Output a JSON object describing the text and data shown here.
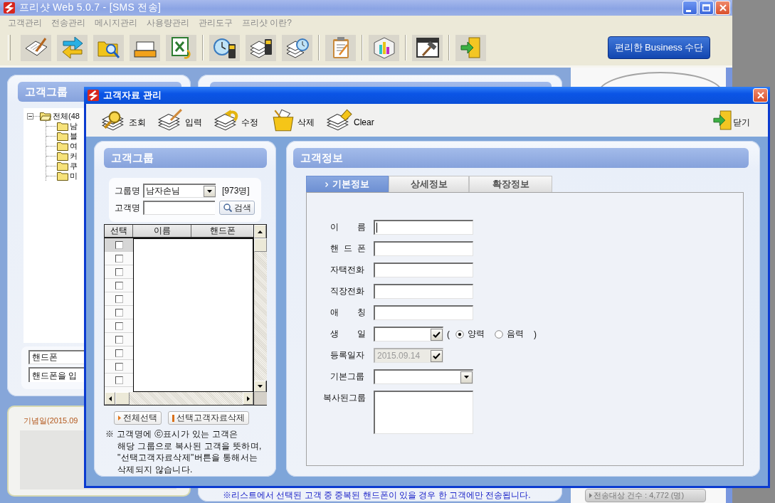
{
  "main_window": {
    "title": "프리샷 Web 5.0.7 - [SMS 전송]",
    "menu": [
      "고객관리",
      "전송관리",
      "메시지관리",
      "사용량관리",
      "관리도구",
      "프리샷 이란?"
    ],
    "business_button": "편리한 Business 수단"
  },
  "group_panel": {
    "title": "고객그룹",
    "tree": {
      "label": "전체(48",
      "expanded": true,
      "children": [
        {
          "label": "남"
        },
        {
          "label": "블"
        },
        {
          "label": "여"
        },
        {
          "label": "커"
        },
        {
          "label": "쿠"
        },
        {
          "label": "미"
        }
      ]
    },
    "search_type": "핸드폰",
    "search_value": "핸드폰을 입"
  },
  "anniversary_panel": {
    "title": "기념일(2015.09"
  },
  "send_panel": {
    "notice": "※리스트에서 선택된 고객 중 중복된 핸드폰이 있을 경우 한 고객에만 전송됩니다."
  },
  "side_panel": {
    "count_button": "전송대상 건수 : 4,772 (명)"
  },
  "dialog": {
    "title": "고객자료 관리",
    "tools": [
      {
        "label": "조회"
      },
      {
        "label": "입력"
      },
      {
        "label": "수정"
      },
      {
        "label": "삭제"
      },
      {
        "label": "Clear"
      }
    ],
    "close_label": "닫기",
    "group_panel": {
      "title": "고객그룹",
      "group_label": "그룹명",
      "group_value": "남자손님",
      "group_count": "[973명]",
      "name_label": "고객명",
      "search_button": "검색",
      "columns": [
        "선택",
        "이름",
        "핸드폰"
      ],
      "rows": [
        {
          "checked": false,
          "selected": true
        },
        {
          "checked": false,
          "selected": false
        },
        {
          "checked": false,
          "selected": false
        },
        {
          "checked": false,
          "selected": false
        },
        {
          "checked": false,
          "selected": false
        },
        {
          "checked": false,
          "selected": false
        },
        {
          "checked": false,
          "selected": false
        },
        {
          "checked": false,
          "selected": false
        },
        {
          "checked": false,
          "selected": false
        },
        {
          "checked": false,
          "selected": false
        },
        {
          "checked": false,
          "selected": false
        }
      ],
      "select_all_button": "전체선택",
      "delete_button": "선택고객자료삭제",
      "note": "※ 고객명에 ⓒ표시가 있는 고객은\n해당 그룹으로 복사된 고객을 뜻하며,\n\"선택고객자료삭제\"버튼을 통해서는\n삭제되지 않습니다."
    },
    "info_panel": {
      "title": "고객정보",
      "tabs": [
        {
          "label": "기본정보",
          "selected": true
        },
        {
          "label": "상세정보",
          "selected": false
        },
        {
          "label": "확장정보",
          "selected": false
        }
      ],
      "fields": [
        {
          "kind": "text",
          "label": "이 름",
          "focused": true,
          "disabled": false
        },
        {
          "kind": "text",
          "label": "핸 드 폰",
          "focused": false,
          "disabled": false
        },
        {
          "kind": "text",
          "label": "자택전화",
          "focused": false,
          "disabled": false
        },
        {
          "kind": "text",
          "label": "직장전화",
          "focused": false,
          "disabled": false
        },
        {
          "kind": "text",
          "label": "애 칭",
          "focused": false,
          "disabled": false
        },
        {
          "kind": "date",
          "label": "생 일",
          "focused": false,
          "disabled": false,
          "calendar": {
            "open": "(",
            "options": [
              {
                "label": "양력",
                "selected": true
              },
              {
                "label": "음력",
                "selected": false
              }
            ],
            "close": ")"
          }
        },
        {
          "kind": "date",
          "label": "등록일자",
          "value": "2015.09.14",
          "focused": false,
          "disabled": true
        },
        {
          "kind": "select",
          "label": "기본그룹",
          "focused": false,
          "disabled": false
        },
        {
          "kind": "textarea",
          "label": "복사된그룹",
          "focused": false,
          "disabled": false
        }
      ]
    }
  }
}
